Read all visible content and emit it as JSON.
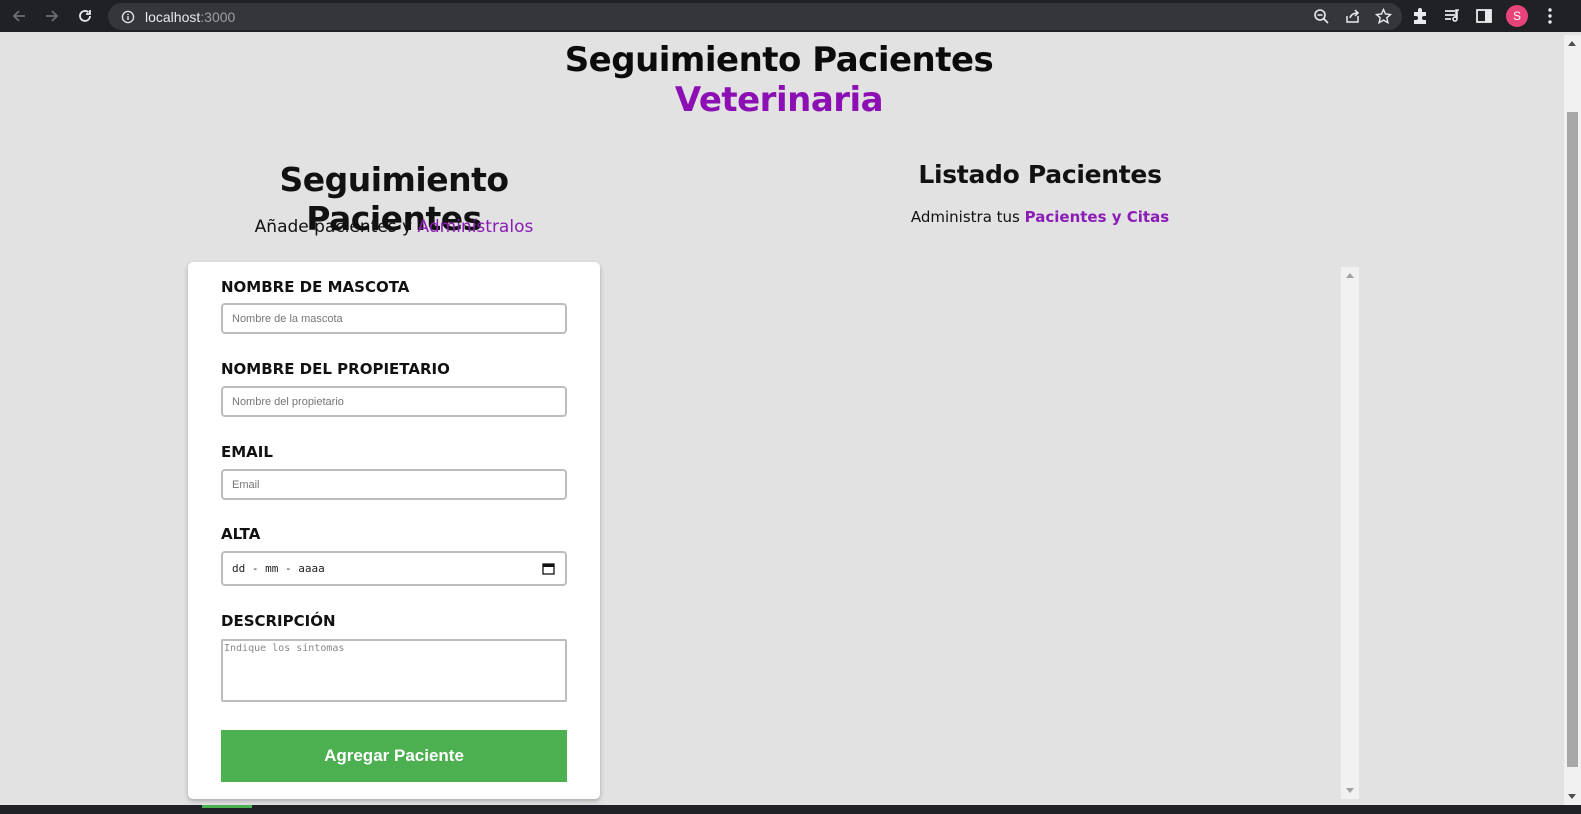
{
  "browser": {
    "url_host": "localhost",
    "url_port": ":3000",
    "profile_initial": "S",
    "colors": {
      "chrome_bg": "#202124",
      "omnibox_bg": "#35363a",
      "avatar": "#e8447a"
    },
    "icons": [
      "back-icon",
      "forward-icon",
      "reload-icon",
      "info-icon",
      "zoom-icon",
      "share-icon",
      "star-icon",
      "extensions-icon",
      "media-icon",
      "sidepanel-icon",
      "menu-icon"
    ]
  },
  "header": {
    "title": "Seguimiento Pacientes",
    "subtitle": "Veterinaria"
  },
  "form_section": {
    "title": "Seguimiento Pacientes",
    "desc_prefix": "Añade pacientes y ",
    "desc_highlight": "Adminístralos",
    "fields": {
      "pet_label": "NOMBRE DE MASCOTA",
      "pet_placeholder": "Nombre de la mascota",
      "owner_label": "NOMBRE DEL PROPIETARIO",
      "owner_placeholder": "Nombre del propietario",
      "email_label": "EMAIL",
      "email_placeholder": "Email",
      "date_label": "ALTA",
      "date_placeholder": "dd - mm - aaaa",
      "desc_label": "DESCRIPCIÓN",
      "desc_placeholder": "Indique los síntomas"
    },
    "submit_label": "Agregar Paciente"
  },
  "list_section": {
    "title": "Listado Pacientes",
    "desc_prefix": "Administra tus ",
    "desc_highlight": "Pacientes y Citas"
  },
  "theme": {
    "accent": "#8b0fb3",
    "button": "#4caf50",
    "background": "#e2e2e3"
  }
}
